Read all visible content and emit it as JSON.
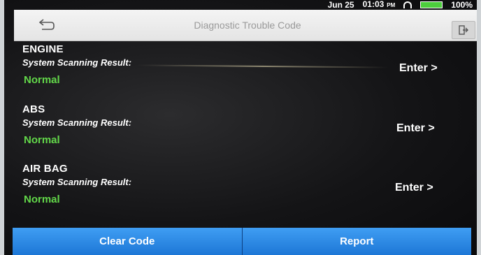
{
  "status_bar": {
    "date": "Jun 25",
    "time": "01:03",
    "ampm": "PM",
    "battery": "100%"
  },
  "header": {
    "title": "Diagnostic Trouble Code"
  },
  "systems": [
    {
      "name": "ENGINE",
      "label": "System Scanning Result:",
      "status": "Normal",
      "action": "Enter >"
    },
    {
      "name": "ABS",
      "label": "System Scanning Result:",
      "status": "Normal",
      "action": "Enter >"
    },
    {
      "name": "AIR BAG",
      "label": "System Scanning Result:",
      "status": "Normal",
      "action": "Enter >"
    }
  ],
  "bottom_bar": {
    "clear_code_label": "Clear Code",
    "report_label": "Report"
  },
  "colors": {
    "status_normal": "#63d84a",
    "button_blue": "#2a88e4",
    "battery_green": "#4ccd3c"
  }
}
